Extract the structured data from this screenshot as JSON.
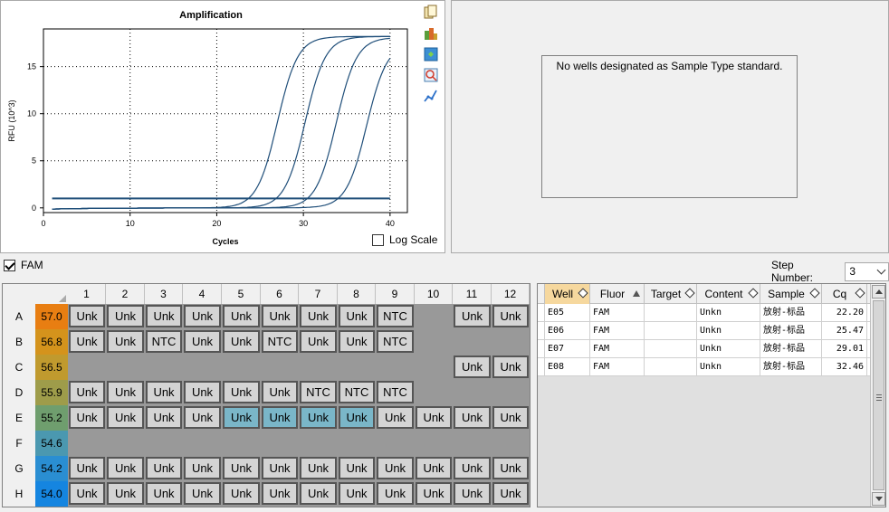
{
  "chart": {
    "title": "Amplification",
    "xlabel": "Cycles",
    "ylabel": "RFU (10^3)",
    "log_scale_label": "Log Scale",
    "log_scale_checked": false
  },
  "chart_data": {
    "type": "line",
    "title": "Amplification",
    "xlabel": "Cycles",
    "ylabel": "RFU (10^3)",
    "xlim": [
      0,
      42
    ],
    "ylim": [
      -0.5,
      19
    ],
    "xticks": [
      0,
      10,
      20,
      30,
      40
    ],
    "yticks": [
      0,
      5,
      10,
      15
    ],
    "grid": true,
    "threshold": 1.0,
    "series": [
      {
        "midpoint": 27.0,
        "max": 18.2,
        "slope": 0.85
      },
      {
        "midpoint": 30.2,
        "max": 18.2,
        "slope": 0.85
      },
      {
        "midpoint": 33.8,
        "max": 18.1,
        "slope": 0.85
      },
      {
        "midpoint": 37.3,
        "max": 17.5,
        "slope": 0.85
      }
    ],
    "line_color": "#1f4e79"
  },
  "toolbar_icons": [
    "copy-icon",
    "export-icon",
    "settings-icon",
    "zoom-icon",
    "curve-icon"
  ],
  "std_curve": {
    "message": "No wells designated as Sample Type standard."
  },
  "fluor": {
    "label": "FAM",
    "checked": true
  },
  "step": {
    "label": "Step Number:",
    "value": "3"
  },
  "plate": {
    "columns": [
      "1",
      "2",
      "3",
      "4",
      "5",
      "6",
      "7",
      "8",
      "9",
      "10",
      "11",
      "12"
    ],
    "rows": [
      {
        "label": "A",
        "temp": "57.0",
        "temp_color": "#e87e12",
        "wells": [
          "Unk",
          "Unk",
          "Unk",
          "Unk",
          "Unk",
          "Unk",
          "Unk",
          "Unk",
          "NTC",
          "",
          "Unk",
          "Unk"
        ]
      },
      {
        "label": "B",
        "temp": "56.8",
        "temp_color": "#d4931c",
        "wells": [
          "Unk",
          "Unk",
          "NTC",
          "Unk",
          "Unk",
          "NTC",
          "Unk",
          "Unk",
          "NTC",
          "",
          "",
          ""
        ]
      },
      {
        "label": "C",
        "temp": "56.5",
        "temp_color": "#c09a2e",
        "wells": [
          "",
          "",
          "",
          "",
          "",
          "",
          "",
          "",
          "",
          "",
          "Unk",
          "Unk"
        ]
      },
      {
        "label": "D",
        "temp": "55.9",
        "temp_color": "#9e9c4a",
        "wells": [
          "Unk",
          "Unk",
          "Unk",
          "Unk",
          "Unk",
          "Unk",
          "NTC",
          "NTC",
          "NTC",
          "",
          "",
          ""
        ]
      },
      {
        "label": "E",
        "temp": "55.2",
        "temp_color": "#6f9e6e",
        "wells": [
          "Unk",
          "Unk",
          "Unk",
          "Unk",
          "Unk",
          "Unk",
          "Unk",
          "Unk",
          "Unk",
          "Unk",
          "Unk",
          "Unk"
        ]
      },
      {
        "label": "F",
        "temp": "54.6",
        "temp_color": "#4b98b0",
        "wells": [
          "",
          "",
          "",
          "",
          "",
          "",
          "",
          "",
          "",
          "",
          "",
          ""
        ]
      },
      {
        "label": "G",
        "temp": "54.2",
        "temp_color": "#2a8ed2",
        "wells": [
          "Unk",
          "Unk",
          "Unk",
          "Unk",
          "Unk",
          "Unk",
          "Unk",
          "Unk",
          "Unk",
          "Unk",
          "Unk",
          "Unk"
        ]
      },
      {
        "label": "H",
        "temp": "54.0",
        "temp_color": "#1585e0",
        "wells": [
          "Unk",
          "Unk",
          "Unk",
          "Unk",
          "Unk",
          "Unk",
          "Unk",
          "Unk",
          "Unk",
          "Unk",
          "Unk",
          "Unk"
        ]
      }
    ],
    "selected_wells": [
      "E5",
      "E6",
      "E7",
      "E8"
    ]
  },
  "results": {
    "headers": [
      "Well",
      "Fluor",
      "Target",
      "Content",
      "Sample",
      "Cq"
    ],
    "rows": [
      {
        "well": "E05",
        "fluor": "FAM",
        "target": "",
        "content": "Unkn",
        "sample": "放射-标品",
        "cq": "22.20"
      },
      {
        "well": "E06",
        "fluor": "FAM",
        "target": "",
        "content": "Unkn",
        "sample": "放射-标品",
        "cq": "25.47"
      },
      {
        "well": "E07",
        "fluor": "FAM",
        "target": "",
        "content": "Unkn",
        "sample": "放射-标品",
        "cq": "29.01"
      },
      {
        "well": "E08",
        "fluor": "FAM",
        "target": "",
        "content": "Unkn",
        "sample": "放射-标品",
        "cq": "32.46"
      }
    ]
  }
}
